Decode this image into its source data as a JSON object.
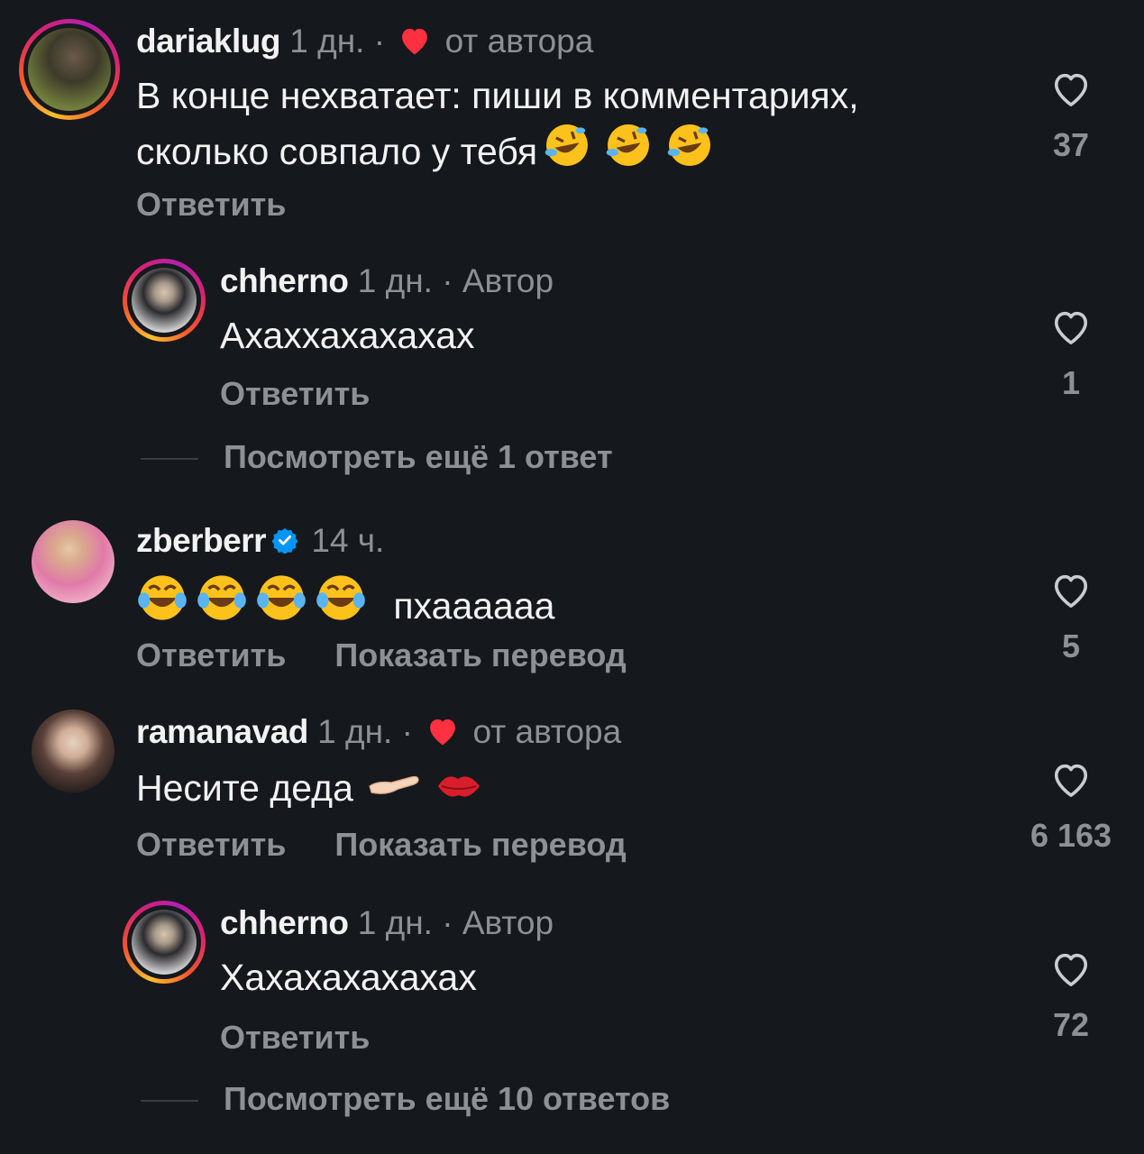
{
  "comments": [
    {
      "username": "dariaklug",
      "time": "1 дн.",
      "separator": "·",
      "liked_by_author_label": "от автора",
      "text": "В конце нехватает: пиши в комментариях,",
      "text_line2": "сколько совпало у тебя",
      "reply_label": "Ответить",
      "likes": "37"
    },
    {
      "username": "chherno",
      "time": "1 дн.",
      "separator": "·",
      "author_label": "Автор",
      "text": "Ахаххахахахах",
      "reply_label": "Ответить",
      "likes": "1",
      "more_replies": "Посмотреть ещё 1 ответ"
    },
    {
      "username": "zberberr",
      "time": "14 ч.",
      "text": "пхаааааа",
      "reply_label": "Ответить",
      "translate_label": "Показать перевод",
      "likes": "5"
    },
    {
      "username": "ramanavad",
      "time": "1 дн.",
      "separator": "·",
      "liked_by_author_label": "от автора",
      "text": "Несите деда",
      "reply_label": "Ответить",
      "translate_label": "Показать перевод",
      "likes": "6 163"
    },
    {
      "username": "chherno",
      "time": "1 дн.",
      "separator": "·",
      "author_label": "Автор",
      "text": "Хахахахахахах",
      "reply_label": "Ответить",
      "likes": "72",
      "more_replies": "Посмотреть ещё 10 ответов"
    }
  ],
  "colors": {
    "background": "#15181d",
    "muted": "#8d9196",
    "heart_red": "#ff3040",
    "verified_blue": "#0095f6"
  },
  "icons": {
    "like": "heart-outline-icon",
    "author_like": "heart-filled-icon",
    "verified": "verified-badge-icon",
    "emoji_rofl": "rolling-laughing-emoji",
    "emoji_joy": "tears-of-joy-emoji",
    "emoji_palm": "palm-up-hand-emoji",
    "emoji_kiss": "kiss-mark-emoji"
  }
}
